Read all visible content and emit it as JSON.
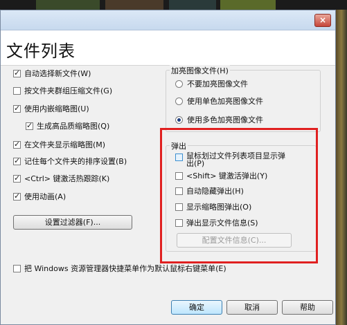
{
  "header": {
    "title": "文件列表",
    "close_glyph": "×"
  },
  "left_options": [
    {
      "label": "自动选择新文件(W)",
      "checked": true
    },
    {
      "label": "按文件夹群组压缩文件(G)",
      "checked": false
    },
    {
      "label": "使用内嵌缩略图(U)",
      "checked": true
    },
    {
      "label": "生成高品质缩略图(Q)",
      "checked": true
    },
    {
      "label": "在文件夹显示缩略图(M)",
      "checked": true
    },
    {
      "label": "记住每个文件夹的排序设置(B)",
      "checked": true
    },
    {
      "label": "<Ctrl> 键激活热跟踪(K)",
      "checked": true
    },
    {
      "label": "使用动画(A)",
      "checked": true
    }
  ],
  "filter_button": "设置过滤器(F)...",
  "highlight_group": {
    "title": "加亮图像文件(H)",
    "options": [
      {
        "label": "不要加亮图像文件",
        "selected": false
      },
      {
        "label": "使用单色加亮图像文件",
        "selected": false
      },
      {
        "label": "使用多色加亮图像文件",
        "selected": true
      }
    ]
  },
  "popup_group": {
    "title": "弹出",
    "first_line": "鼠标划过文件列表项目显示弹",
    "first_line_2": "出(P)",
    "options": [
      {
        "label": "<Shift> 键激活弹出(Y)",
        "checked": false
      },
      {
        "label": "自动隐藏弹出(H)",
        "checked": false
      },
      {
        "label": "显示缩略图弹出(O)",
        "checked": false
      },
      {
        "label": "弹出显示文件信息(S)",
        "checked": false
      }
    ],
    "config_button": "配置文件信息(C)..."
  },
  "bottom_option": {
    "label": "把 Windows 资源管理器快捷菜单作为默认鼠标右键菜单(E)",
    "checked": false
  },
  "buttons": {
    "ok": "确定",
    "cancel": "取消",
    "help": "帮助"
  },
  "accent_colors": {
    "highlight_border": "#e02020",
    "primary_button": "#3c7fb1"
  }
}
